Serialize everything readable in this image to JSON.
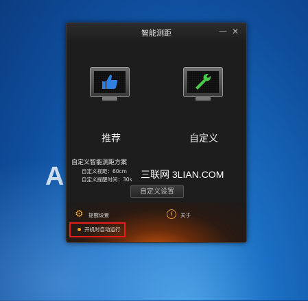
{
  "window": {
    "title": "智能测距",
    "minimize_glyph": "—",
    "close_glyph": "✕"
  },
  "options": [
    {
      "label": "推荐",
      "icon": "thumbs-up-icon",
      "icon_color": "#2f7fe0"
    },
    {
      "label": "自定义",
      "icon": "wrench-icon",
      "icon_color": "#48c94a"
    }
  ],
  "custom_plan": {
    "title": "自定义智能测距方案",
    "distance_line": "自定义视距：60cm",
    "remind_line": "自定义提醒时间：30s",
    "settings_button": "自定义设置"
  },
  "watermark": "三联网 3LIAN.COM",
  "footer": {
    "remind_settings": "提醒设置",
    "about": "关于",
    "autostart": "开机时自动运行",
    "accent_color": "#e39a2a",
    "highlight_color": "#e81c1c"
  },
  "desktop": {
    "letter": "A"
  }
}
